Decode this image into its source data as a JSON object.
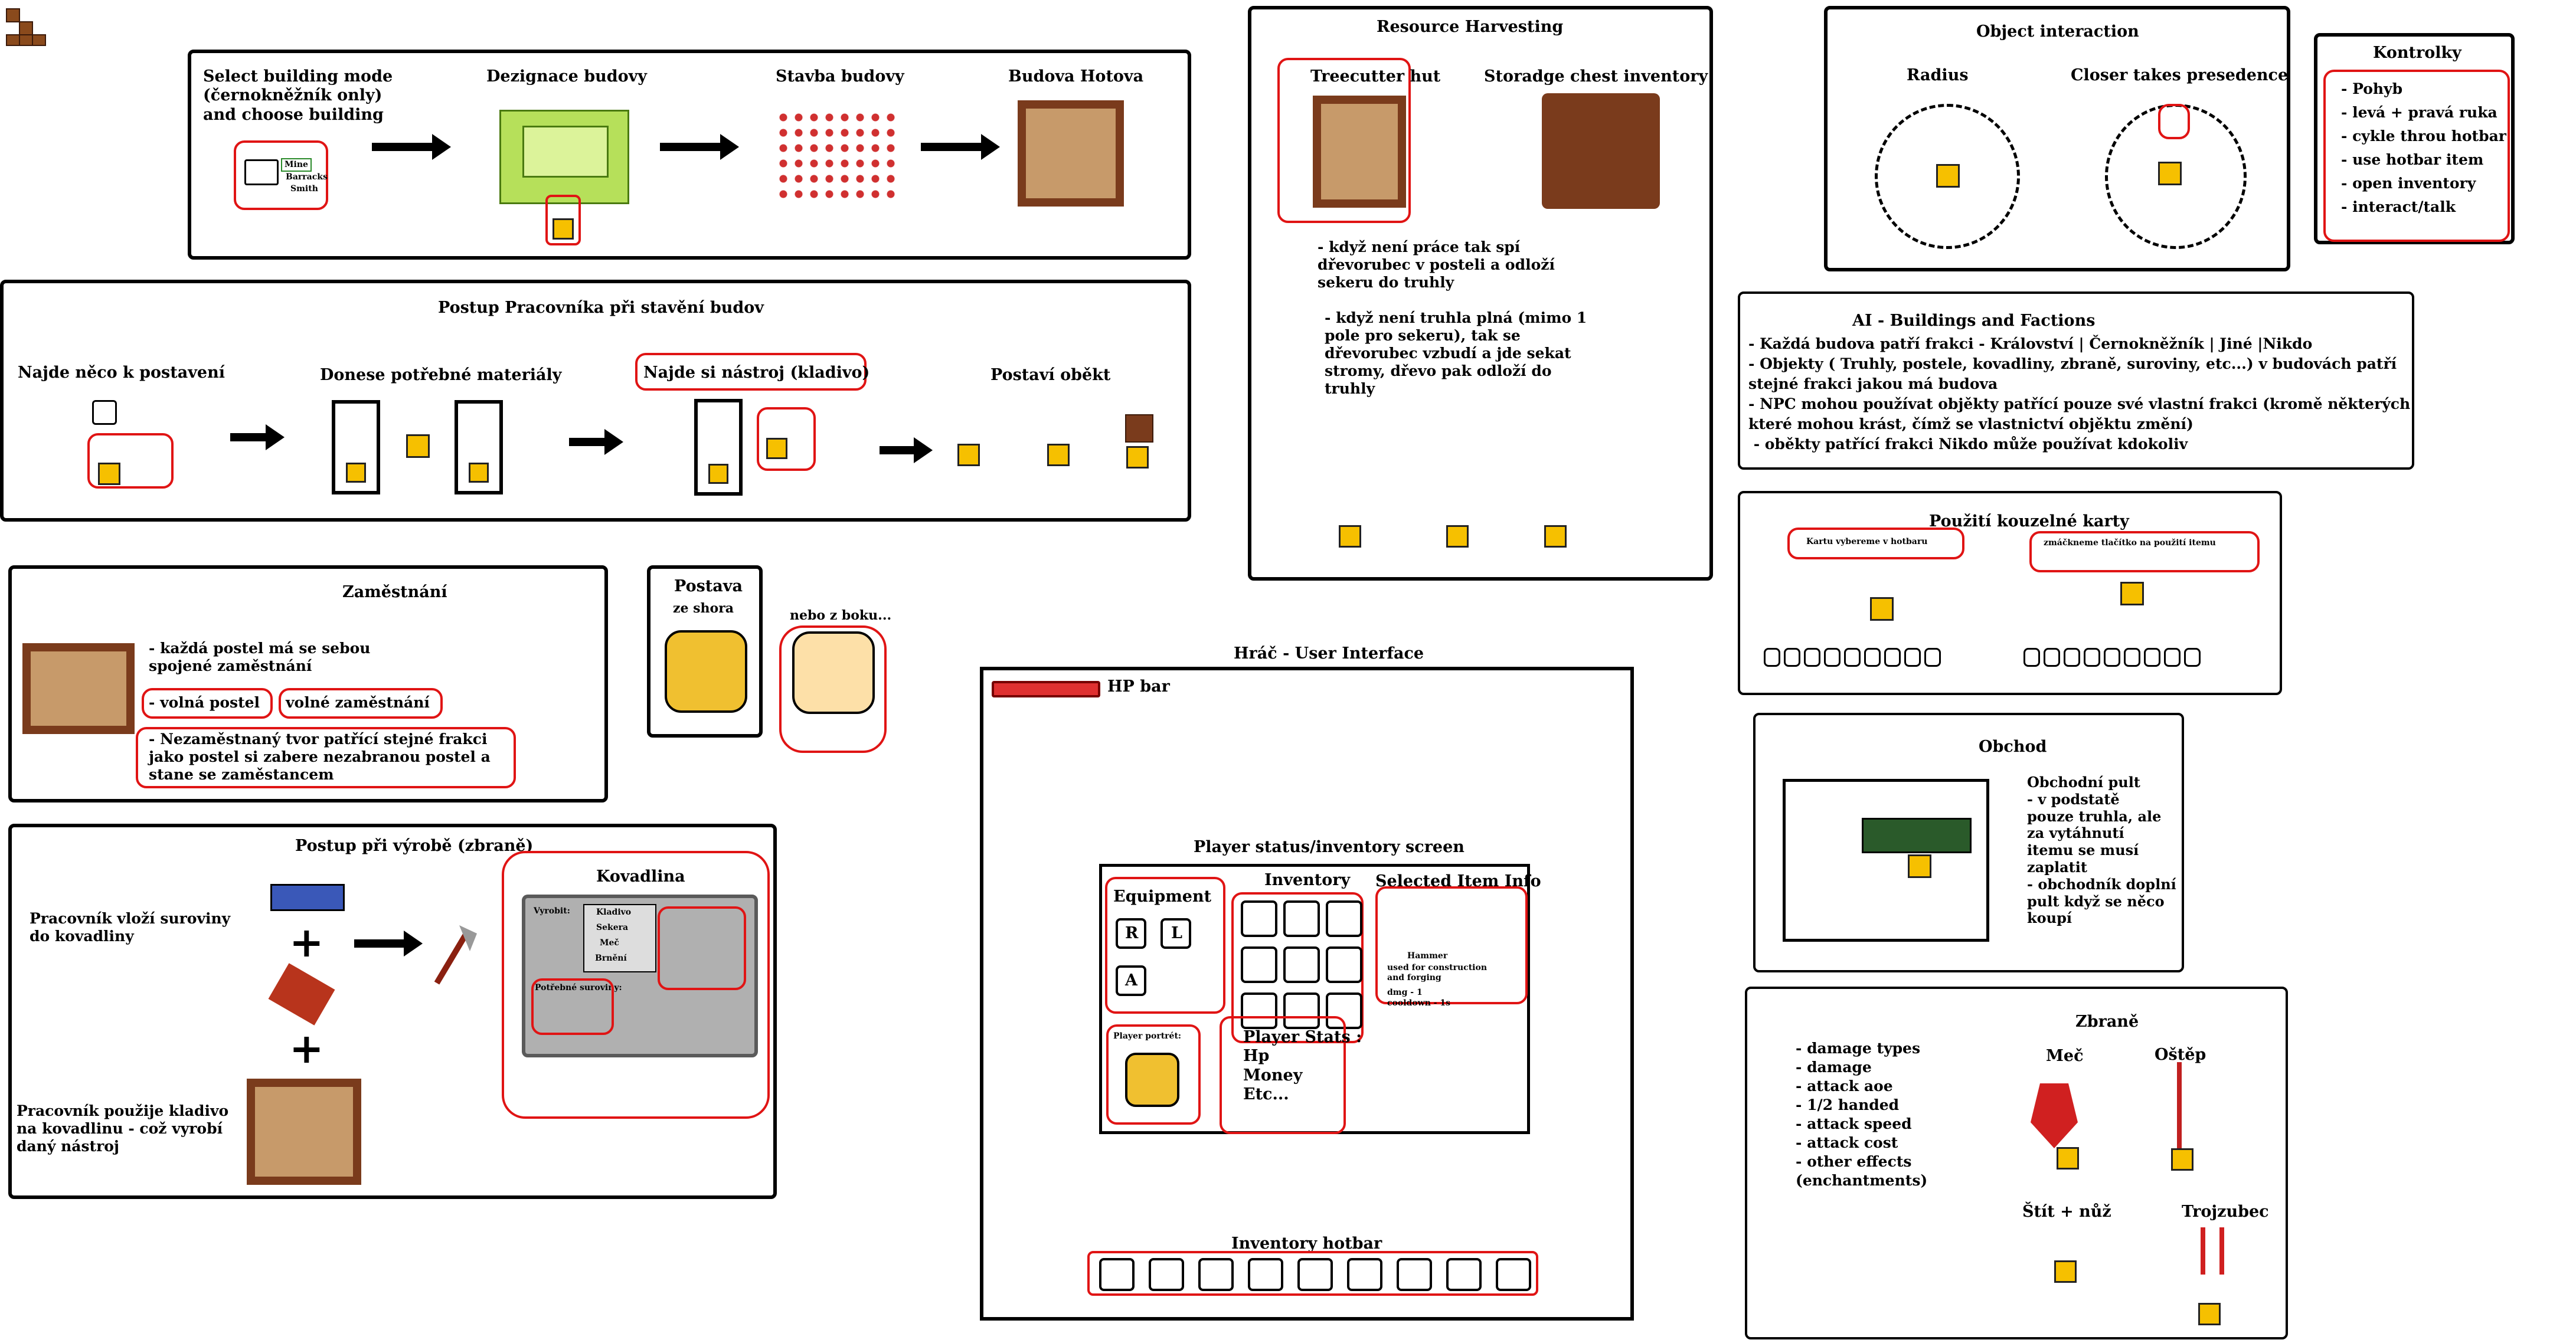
{
  "icons_topleft": "brick-icons",
  "building": {
    "step1": "Select building mode\n(černokněžník only)\nand choose building",
    "menu": [
      "Mine",
      "Barracks",
      "Smith"
    ],
    "step2": "Dezignace budovy",
    "step3": "Stavba budovy",
    "step4": "Budova Hotova"
  },
  "worker": {
    "title": "Postup Pracovníka při stavění budov",
    "s1": "Najde něco k postavení",
    "s2": "Donese potřebné materiály",
    "s3": "Najde si nástroj (kladivo)",
    "s4": "Postaví oběkt"
  },
  "resource": {
    "title": "Resource Harvesting",
    "hut": "Treecutter hut",
    "chest": "Storadge chest inventory",
    "note1": "- když není práce tak spí\ndřevorubec v posteli a odloží\nsekeru do truhly",
    "note2": "- když není truhla plná (mimo 1\npole pro sekeru), tak se\ndřevorubec vzbudí a jde sekat\nstromy, dřevo pak odloží do\ntruhly"
  },
  "object": {
    "title": "Object interaction",
    "radius": "Radius",
    "closer": "Closer takes presedence"
  },
  "controls": {
    "title": "Kontrolky",
    "items": [
      "- Pohyb",
      "- levá + pravá ruka",
      "- cykle throu hotbar",
      "- use hotbar item",
      "- open inventory",
      "- interact/talk"
    ]
  },
  "ai": {
    "title": "AI - Buildings and Factions",
    "lines": [
      "- Každá budova patří frakci - Království | Černokněžník | Jiné |Nikdo",
      "- Objekty ( Truhly, postele, kovadliny, zbraně, suroviny, etc...) v budovách patří",
      "stejné frakci jakou má budova",
      "- NPC mohou používat objěkty patřící pouze své vlastní frakci (kromě některých",
      "které mohou krást, čímž se vlastnictví objěktu změní)",
      " - oběkty patřící frakci Nikdo může používat kdokoliv"
    ]
  },
  "employment": {
    "title": "Zaměstnání",
    "l1": "- každá postel má se sebou\nspojené zaměstnání",
    "l2a": "- volná postel",
    "l2b": "volné zaměstnání",
    "l3": "- Nezaměstnaný tvor patřící stejné frakci\njako postel si zabere nezabranou postel a\nstane se zaměstancem"
  },
  "character": {
    "title": "Postava",
    "sub": "ze shora",
    "side": "nebo z boku..."
  },
  "magic": {
    "title": "Použití kouzelné karty",
    "left": "Kartu vybereme v hotbaru",
    "right": "zmáčkneme tlačítko na použití itemu"
  },
  "crafting": {
    "title": "Postup při výrobě (zbraně)",
    "l1": "Pracovník vloží suroviny\ndo kovadliny",
    "l2": "Pracovník použije kladivo\nna kovadlinu - což vyrobí\ndaný nástroj",
    "anvil": "Kovadlina",
    "vyrobit": "Vyrobit:",
    "options": [
      "Kladivo",
      "Sekera",
      "Meč",
      "Brnění"
    ],
    "need": "Potřebné suroviny:"
  },
  "ui": {
    "title": "Hráč - User Interface",
    "hp": "HP bar",
    "status": "Player status/inventory screen",
    "equipment": "Equipment",
    "inventory": "Inventory",
    "selected": "Selected Item Info",
    "eq_r": "R",
    "eq_l": "L",
    "eq_a": "A",
    "item_name": "Hammer",
    "item_desc": "used for construction\nand forging",
    "item_dmg": "dmg - 1",
    "item_cd": "cooldown - 1s",
    "portrait": "Player portrét:",
    "stats": "Player Stats :\nHp\nMoney\nEtc...",
    "hotbar": "Inventory hotbar"
  },
  "shop": {
    "title": "Obchod",
    "text": "Obchodní pult\n- v podstatě\npouze truhla, ale\nza vytáhnutí\nitemu se musí\nzaplatit\n- obchodník doplní\npult když se něco\nkoupí"
  },
  "weapons": {
    "title": "Zbraně",
    "list": [
      "- damage types",
      "- damage",
      "- attack aoe",
      "- 1/2 handed",
      "- attack speed",
      "- attack cost",
      "- other effects",
      "(enchantments)"
    ],
    "sword": "Meč",
    "spear": "Oštěp",
    "shield": "Štít + nůž",
    "trident": "Trojzubec"
  }
}
